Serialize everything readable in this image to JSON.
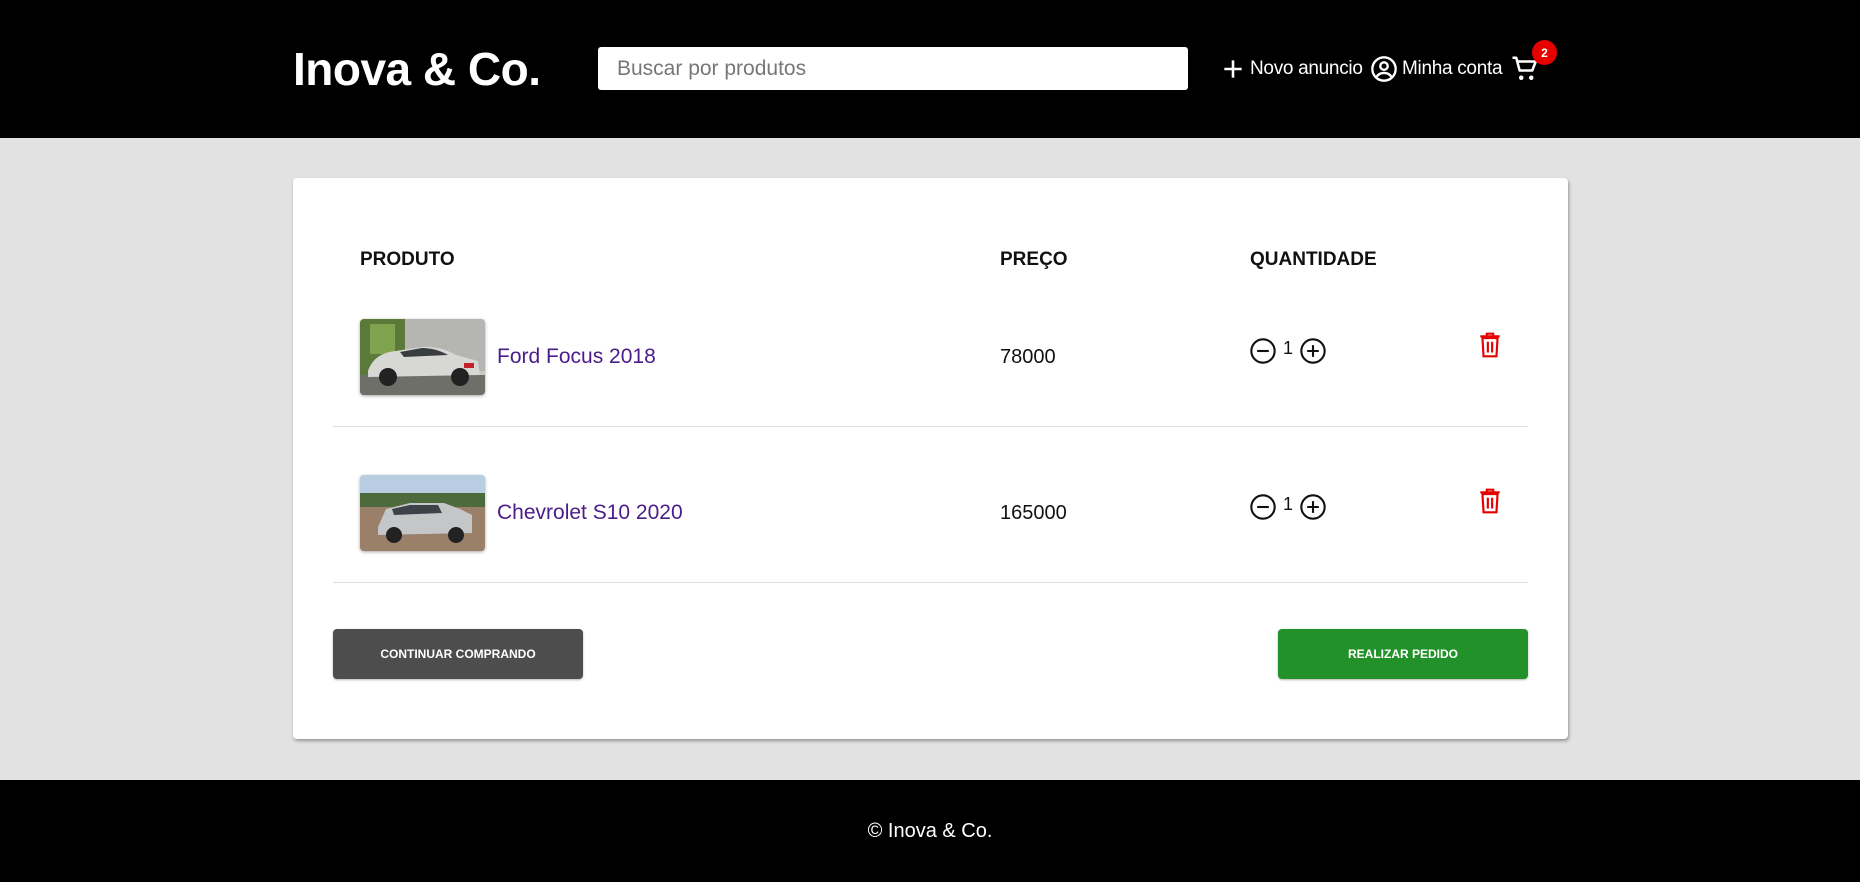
{
  "header": {
    "logo": "Inova & Co.",
    "search_placeholder": "Buscar por produtos",
    "new_ad_label": "Novo anuncio",
    "account_label": "Minha conta",
    "cart_count": "2"
  },
  "table": {
    "headers": {
      "product": "PRODUTO",
      "price": "PREÇO",
      "quantity": "QUANTIDADE"
    },
    "rows": [
      {
        "name": "Ford Focus 2018",
        "price": "78000",
        "quantity": "1"
      },
      {
        "name": "Chevrolet S10 2020",
        "price": "165000",
        "quantity": "1"
      }
    ]
  },
  "actions": {
    "continue_label": "CONTINUAR COMPRANDO",
    "order_label": "REALIZAR PEDIDO"
  },
  "footer": {
    "copyright": "© Inova & Co."
  },
  "colors": {
    "header_bg": "#000000",
    "page_bg": "#e2e2e2",
    "badge": "#e60000",
    "product_link": "#4b1d8a",
    "delete": "#e60000",
    "continue_button": "#4d4d4d",
    "order_button": "#22912a"
  }
}
